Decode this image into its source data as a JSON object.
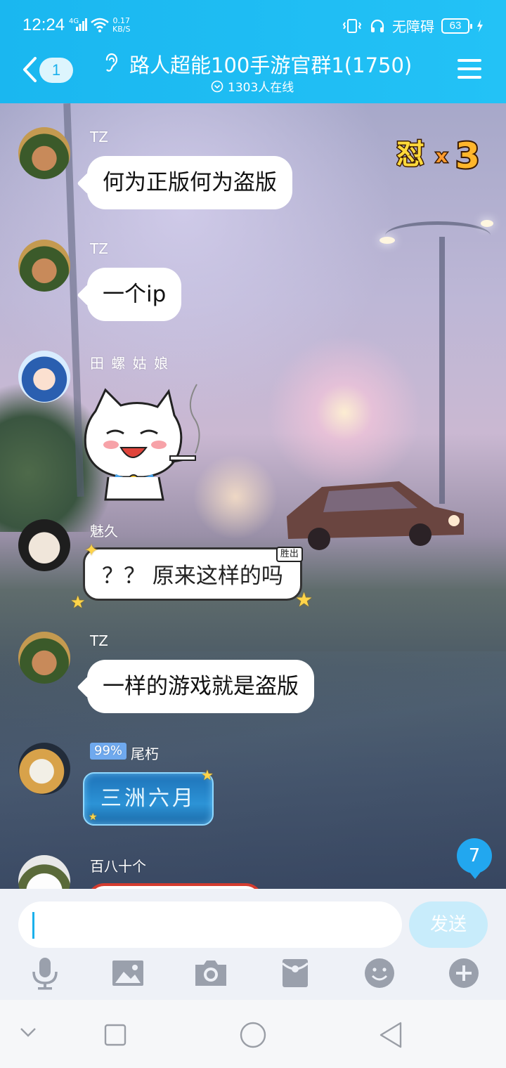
{
  "status_bar": {
    "time": "12:24",
    "network": "4G",
    "speed_value": "0.17",
    "speed_unit": "KB/S",
    "accessibility": "无障碍",
    "battery": "63"
  },
  "header": {
    "back_count": "1",
    "title": "路人超能100手游官群1(1750)",
    "online": "1303人在线"
  },
  "chat": {
    "badge_text": "怼x3",
    "messages": [
      {
        "sender": "TZ",
        "text": "何为正版何为盗版"
      },
      {
        "sender": "TZ",
        "text": "一个ip"
      },
      {
        "sender": "田 螺 姑 娘",
        "text": ""
      },
      {
        "sender": "魅久",
        "text": "？？ 原来这样的吗",
        "tag": "胜出"
      },
      {
        "sender": "TZ",
        "text": "一样的游戏就是盗版"
      },
      {
        "sender": "尾朽",
        "level": "99%",
        "text": "三洲六月"
      },
      {
        "sender": "百八十个",
        "text": ""
      }
    ],
    "unread_count": "7"
  },
  "input": {
    "value": "",
    "send_label": "发送"
  },
  "toolbar": [
    "microphone-icon",
    "image-icon",
    "camera-icon",
    "red-packet-icon",
    "emoji-icon",
    "plus-icon"
  ],
  "colors": {
    "header": "#1ab7f0",
    "send_disabled": "#c8ecfb",
    "bubble": "#ffffff"
  }
}
